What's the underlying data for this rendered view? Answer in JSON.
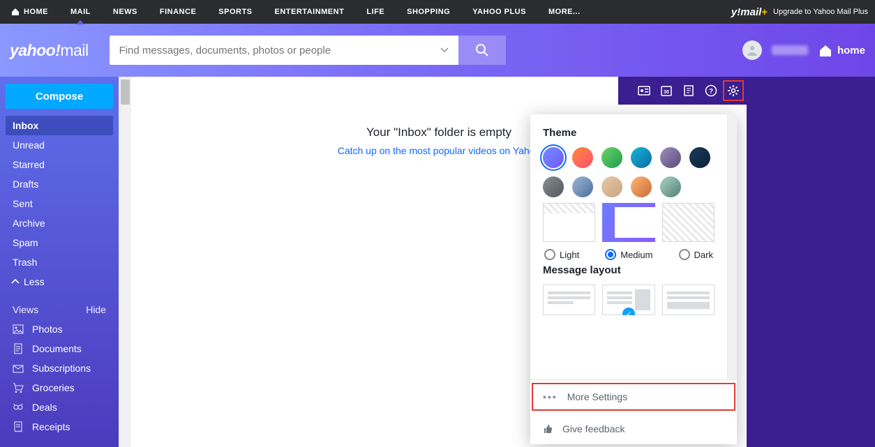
{
  "topnav": {
    "items": [
      {
        "label": "HOME"
      },
      {
        "label": "MAIL"
      },
      {
        "label": "NEWS"
      },
      {
        "label": "FINANCE"
      },
      {
        "label": "SPORTS"
      },
      {
        "label": "ENTERTAINMENT"
      },
      {
        "label": "LIFE"
      },
      {
        "label": "SHOPPING"
      },
      {
        "label": "YAHOO PLUS"
      },
      {
        "label": "MORE..."
      }
    ],
    "upgrade_brand": "y!mail",
    "upgrade_plus": "+",
    "upgrade_text": "Upgrade to Yahoo Mail Plus"
  },
  "header": {
    "logo_main": "yahoo!",
    "logo_sub": "mail",
    "search_placeholder": "Find messages, documents, photos or people",
    "home_label": "home"
  },
  "rail": {
    "compose": "Compose",
    "folders": [
      {
        "label": "Inbox",
        "selected": true
      },
      {
        "label": "Unread"
      },
      {
        "label": "Starred"
      },
      {
        "label": "Drafts"
      },
      {
        "label": "Sent"
      },
      {
        "label": "Archive"
      },
      {
        "label": "Spam"
      },
      {
        "label": "Trash"
      }
    ],
    "less": "Less",
    "views_label": "Views",
    "hide_label": "Hide",
    "views": [
      {
        "label": "Photos",
        "icon": "photo"
      },
      {
        "label": "Documents",
        "icon": "doc"
      },
      {
        "label": "Subscriptions",
        "icon": "sub"
      },
      {
        "label": "Groceries",
        "icon": "cart"
      },
      {
        "label": "Deals",
        "icon": "deal"
      },
      {
        "label": "Receipts",
        "icon": "receipt"
      }
    ]
  },
  "main": {
    "empty_title": "Your \"Inbox\" folder is empty",
    "empty_link": "Catch up on the most popular videos on Yahoo"
  },
  "settings": {
    "theme_title": "Theme",
    "colors": [
      {
        "bg": "linear-gradient(135deg,#7b8bff,#6d5af9)",
        "selected": true
      },
      {
        "bg": "linear-gradient(135deg,#ff8a3d,#ff4f6d)"
      },
      {
        "bg": "linear-gradient(135deg,#6fd36a,#1a9e4b)"
      },
      {
        "bg": "linear-gradient(135deg,#17b7d4,#0b6aa8)"
      },
      {
        "bg": "linear-gradient(135deg,#9d8fbf,#5a4a7a)"
      },
      {
        "bg": "linear-gradient(135deg,#1b3a5b,#0c2238)"
      },
      {
        "bg": "linear-gradient(135deg,#8b9096,#52565b)"
      },
      {
        "bg": "linear-gradient(135deg,#9fb8d6,#4a6f9a)"
      },
      {
        "bg": "linear-gradient(135deg,#e7c8a8,#caa57e)"
      },
      {
        "bg": "linear-gradient(135deg,#ffb870,#c96a3b)"
      },
      {
        "bg": "linear-gradient(135deg,#a9d4c4,#547e74)"
      }
    ],
    "density": [
      {
        "label": "Light",
        "selected": false
      },
      {
        "label": "Medium",
        "selected": true
      },
      {
        "label": "Dark",
        "selected": false
      }
    ],
    "layout_title": "Message layout",
    "layout_selected_index": 1,
    "more_settings": "More Settings",
    "give_feedback": "Give feedback"
  }
}
